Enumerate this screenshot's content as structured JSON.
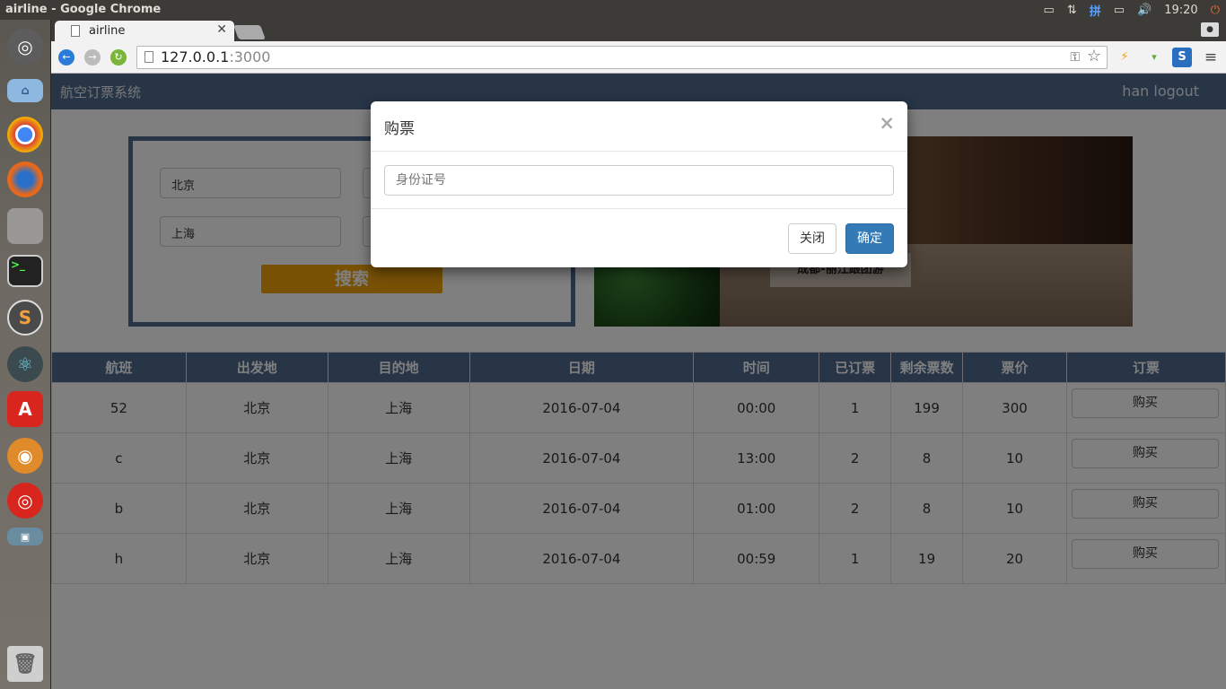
{
  "os": {
    "window_title": "airline - Google Chrome",
    "tray": {
      "input_method": "拼",
      "clock": "19:20"
    }
  },
  "browser": {
    "tab_title": "airline",
    "url_host": "127.0.0.1",
    "url_port": ":3000"
  },
  "app": {
    "brand": "航空订票系统",
    "user": "han logout",
    "search": {
      "from_value": "北京",
      "to_value": "上海",
      "button": "搜索"
    },
    "banner_caption": "成都-丽江跟团游"
  },
  "table": {
    "headers": [
      "航班",
      "出发地",
      "目的地",
      "日期",
      "时间",
      "已订票",
      "剩余票数",
      "票价",
      "订票"
    ],
    "rows": [
      {
        "flight": "52",
        "from": "北京",
        "to": "上海",
        "date": "2016-07-04",
        "time": "00:00",
        "booked": "1",
        "remaining": "199",
        "price": "300",
        "action": "购买"
      },
      {
        "flight": "c",
        "from": "北京",
        "to": "上海",
        "date": "2016-07-04",
        "time": "13:00",
        "booked": "2",
        "remaining": "8",
        "price": "10",
        "action": "购买"
      },
      {
        "flight": "b",
        "from": "北京",
        "to": "上海",
        "date": "2016-07-04",
        "time": "01:00",
        "booked": "2",
        "remaining": "8",
        "price": "10",
        "action": "购买"
      },
      {
        "flight": "h",
        "from": "北京",
        "to": "上海",
        "date": "2016-07-04",
        "time": "00:59",
        "booked": "1",
        "remaining": "19",
        "price": "20",
        "action": "购买"
      }
    ]
  },
  "modal": {
    "title": "购票",
    "close_symbol": "×",
    "id_placeholder": "身份证号",
    "close_label": "关闭",
    "confirm_label": "确定"
  },
  "colors": {
    "navbar": "#4f6b8f",
    "primary": "#337ab7",
    "search_button": "#f0a30a"
  }
}
